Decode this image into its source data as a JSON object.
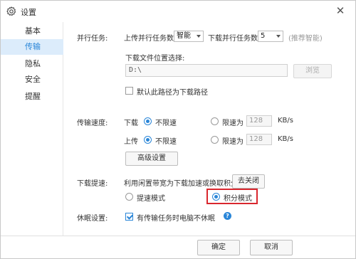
{
  "window": {
    "title": "设置",
    "close_glyph": "✕"
  },
  "sidebar": {
    "items": [
      {
        "label": "基本",
        "active": false
      },
      {
        "label": "传输",
        "active": true
      },
      {
        "label": "隐私",
        "active": false
      },
      {
        "label": "安全",
        "active": false
      },
      {
        "label": "提醒",
        "active": false
      }
    ]
  },
  "parallel": {
    "section_label": "并行任务:",
    "upload_label": "上传并行任务数",
    "upload_value": "智能",
    "download_label": "下载并行任务数",
    "download_value": "5",
    "hint": "(推荐智能)"
  },
  "download_location": {
    "label": "下载文件位置选择:",
    "path": "D:\\",
    "browse_label": "浏览",
    "default_checkbox_label": "默认此路径为下载路径",
    "default_checked": false
  },
  "speed": {
    "section_label": "传输速度:",
    "download_label": "下载",
    "upload_label": "上传",
    "unlimited_label": "不限速",
    "limit_label": "限速为",
    "download_limit_value": "128",
    "upload_limit_value": "128",
    "unit": "KB/s",
    "download_unlimited": true,
    "upload_unlimited": true,
    "advanced_button": "高级设置"
  },
  "boost": {
    "section_label": "下载提速:",
    "description": "利用闲置带宽为下载加速或换取积分",
    "toggle_button": "去关闭",
    "mode_speed": "提速模式",
    "mode_points": "积分模式",
    "selected_mode": "积分模式"
  },
  "sleep": {
    "section_label": "休眠设置:",
    "checkbox_label": "有传输任务时电脑不休眠",
    "checked": true,
    "help_glyph": "?"
  },
  "footer": {
    "ok_label": "确定",
    "cancel_label": "取消"
  },
  "colors": {
    "accent": "#2a86d8",
    "highlight": "#d9272e",
    "active_bg": "#dcecfb"
  }
}
